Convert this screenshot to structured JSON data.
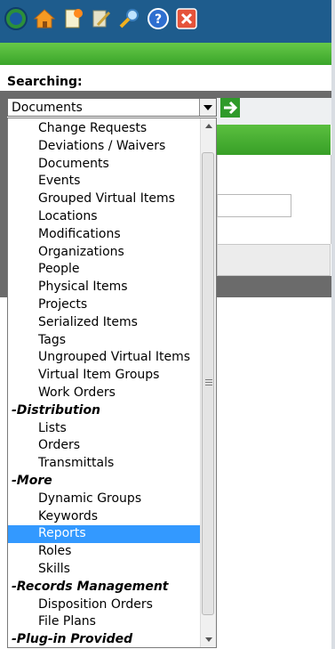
{
  "toolbar": {
    "icons": [
      "logo-icon",
      "home-icon",
      "new-item-icon",
      "tools-icon",
      "search-icon",
      "help-icon",
      "close-icon"
    ],
    "colors": {
      "top": "#1e5c8d",
      "green": "#4cb63a",
      "close": "#e5533a"
    }
  },
  "search": {
    "label": "Searching:",
    "selected_value": "Documents"
  },
  "dropdown": {
    "options": [
      {
        "label": "Change Requests",
        "type": "item"
      },
      {
        "label": "Deviations / Waivers",
        "type": "item"
      },
      {
        "label": "Documents",
        "type": "item"
      },
      {
        "label": "Events",
        "type": "item"
      },
      {
        "label": "Grouped Virtual Items",
        "type": "item"
      },
      {
        "label": "Locations",
        "type": "item"
      },
      {
        "label": "Modifications",
        "type": "item"
      },
      {
        "label": "Organizations",
        "type": "item"
      },
      {
        "label": "People",
        "type": "item"
      },
      {
        "label": "Physical Items",
        "type": "item"
      },
      {
        "label": "Projects",
        "type": "item"
      },
      {
        "label": "Serialized Items",
        "type": "item"
      },
      {
        "label": "Tags",
        "type": "item"
      },
      {
        "label": "Ungrouped Virtual Items",
        "type": "item"
      },
      {
        "label": "Virtual Item Groups",
        "type": "item"
      },
      {
        "label": "Work Orders",
        "type": "item"
      },
      {
        "label": "-Distribution",
        "type": "group"
      },
      {
        "label": "Lists",
        "type": "item"
      },
      {
        "label": "Orders",
        "type": "item"
      },
      {
        "label": "Transmittals",
        "type": "item"
      },
      {
        "label": "-More",
        "type": "group"
      },
      {
        "label": "Dynamic Groups",
        "type": "item"
      },
      {
        "label": "Keywords",
        "type": "item"
      },
      {
        "label": "Reports",
        "type": "item",
        "selected": true
      },
      {
        "label": "Roles",
        "type": "item"
      },
      {
        "label": "Skills",
        "type": "item"
      },
      {
        "label": "-Records Management",
        "type": "group"
      },
      {
        "label": "Disposition Orders",
        "type": "item"
      },
      {
        "label": "File Plans",
        "type": "item"
      },
      {
        "label": "-Plug-in Provided",
        "type": "group"
      }
    ]
  }
}
